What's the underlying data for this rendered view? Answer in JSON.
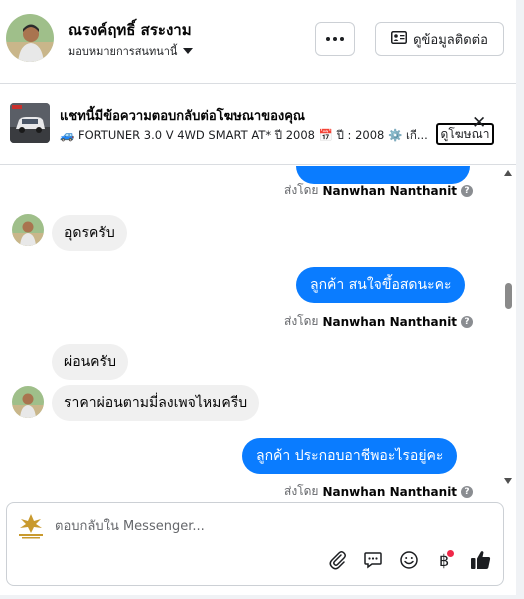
{
  "header": {
    "name": "ณรงค์ฤทธิ์ สระงาม",
    "assignee": "มอบหมายการสนทนานี้",
    "contact_info_label": "ดูข้อมูลติดต่อ"
  },
  "ad": {
    "title": "แชทนี้มีข้อความตอบกลับต่อโฆษณาของคุณ",
    "description": "🚙 FORTUNER 3.0 V 4WD SMART AT* ปี 2008 📅 ปี : 2008 ⚙️ เกี...",
    "view_ad_label": "ดูโฆษณา"
  },
  "messages": [
    {
      "direction": "out",
      "text": ""
    },
    {
      "direction": "meta",
      "prefix": "ส่งโดย",
      "sender": "Nanwhan Nanthanit",
      "help": "?"
    },
    {
      "direction": "in",
      "text": "อุดรครับ"
    },
    {
      "direction": "out",
      "text": "ลูกค้า สนใจขึ้อสดนะคะ"
    },
    {
      "direction": "meta",
      "prefix": "ส่งโดย",
      "sender": "Nanwhan Nanthanit",
      "help": "?"
    },
    {
      "direction": "in",
      "text": "ผ่อนครับ"
    },
    {
      "direction": "in",
      "text": "ราคาผ่อนตามมี่ลงเพจไหมครีบ"
    },
    {
      "direction": "out",
      "text": "ลูกค้า  ประกอบอาชีพอะไรอยู่คะ"
    },
    {
      "direction": "meta",
      "prefix": "ส่งโดย",
      "sender": "Nanwhan Nanthanit",
      "help": "?"
    }
  ],
  "composer": {
    "placeholder": "ตอบกลับใน Messenger...",
    "tools": [
      "attach-icon",
      "saved-reply-icon",
      "emoji-icon",
      "baht-icon",
      "like-icon"
    ]
  },
  "colors": {
    "outgoing_bubble": "#0a7cff",
    "incoming_bubble": "#f0f0f0",
    "notification_dot": "#f02849"
  }
}
